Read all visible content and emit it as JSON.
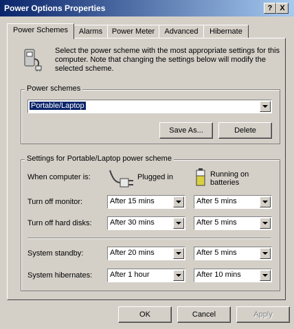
{
  "window": {
    "title": "Power Options Properties",
    "help_btn": "?",
    "close_btn": "X"
  },
  "tabs": [
    {
      "label": "Power Schemes",
      "active": true
    },
    {
      "label": "Alarms",
      "active": false
    },
    {
      "label": "Power Meter",
      "active": false
    },
    {
      "label": "Advanced",
      "active": false
    },
    {
      "label": "Hibernate",
      "active": false
    }
  ],
  "intro_text": "Select the power scheme with the most appropriate settings for this computer. Note that changing the settings below will modify the selected scheme.",
  "schemes": {
    "group_label": "Power schemes",
    "selected": "Portable/Laptop",
    "save_as_label": "Save As...",
    "delete_label": "Delete"
  },
  "settings": {
    "group_label": "Settings for Portable/Laptop power scheme",
    "when_label": "When computer is:",
    "plugged_in_label": "Plugged in",
    "batteries_label": "Running on batteries",
    "rows": [
      {
        "label": "Turn off monitor:",
        "plugged": "After 15 mins",
        "battery": "After 5 mins"
      },
      {
        "label": "Turn off hard disks:",
        "plugged": "After 30 mins",
        "battery": "After 5 mins"
      },
      {
        "label": "System standby:",
        "plugged": "After 20 mins",
        "battery": "After 5 mins"
      },
      {
        "label": "System hibernates:",
        "plugged": "After 1 hour",
        "battery": "After 10 mins"
      }
    ]
  },
  "footer": {
    "ok_label": "OK",
    "cancel_label": "Cancel",
    "apply_label": "Apply"
  },
  "icons": [
    "power-scheme-icon",
    "plug-icon",
    "battery-icon",
    "dropdown-arrow-icon"
  ]
}
